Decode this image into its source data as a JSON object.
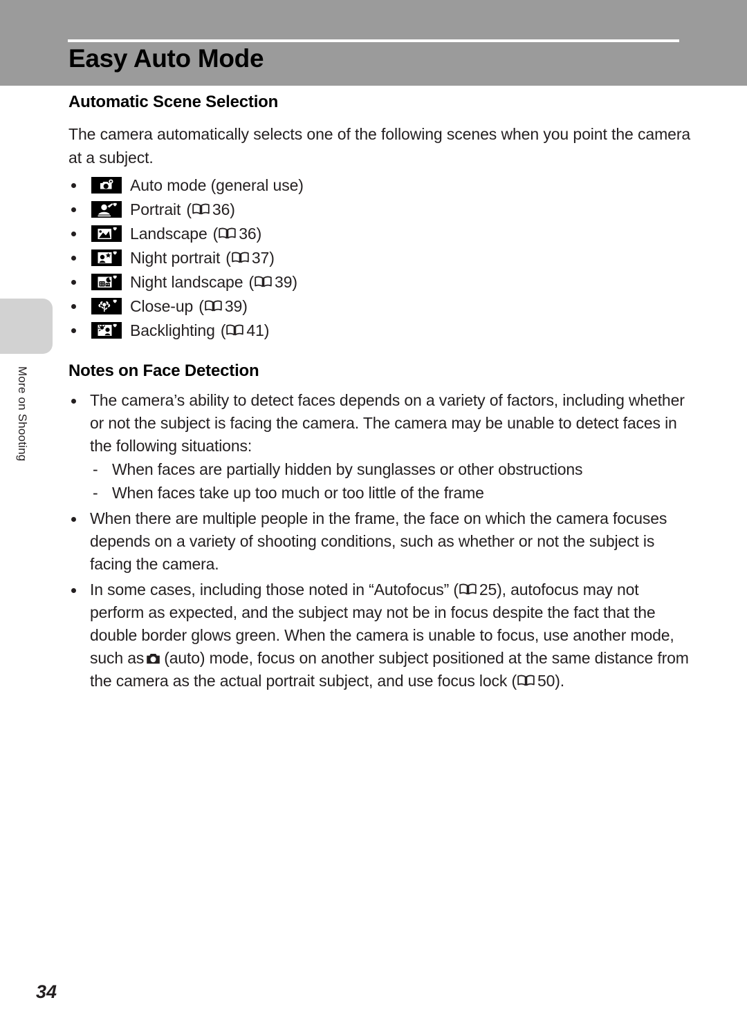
{
  "header": {
    "chapter_title": "Easy Auto Mode",
    "band_color": "#9b9b9b",
    "rule_color": "#ffffff"
  },
  "side_tab": {
    "label": "More on Shooting",
    "tab_color": "#d2d2d2"
  },
  "sections": {
    "automatic_scene_selection": {
      "heading": "Automatic Scene Selection",
      "intro": "The camera automatically selects one of the following scenes when you point the camera at a subject.",
      "scenes": [
        {
          "icon": "auto-mode-icon",
          "label": "Auto mode (general use)",
          "ref_page": ""
        },
        {
          "icon": "portrait-icon",
          "label": "Portrait",
          "ref_open": "(",
          "ref_page": "36",
          "ref_close": ")"
        },
        {
          "icon": "landscape-icon",
          "label": "Landscape",
          "ref_open": "(",
          "ref_page": "36",
          "ref_close": ")"
        },
        {
          "icon": "night-portrait-icon",
          "label": "Night portrait",
          "ref_open": "(",
          "ref_page": "37",
          "ref_close": ")"
        },
        {
          "icon": "night-landscape-icon",
          "label": "Night landscape",
          "ref_open": "(",
          "ref_page": "39",
          "ref_close": ")"
        },
        {
          "icon": "close-up-icon",
          "label": "Close-up",
          "ref_open": "(",
          "ref_page": "39",
          "ref_close": ")"
        },
        {
          "icon": "backlighting-icon",
          "label": "Backlighting",
          "ref_open": "(",
          "ref_page": "41",
          "ref_close": ")"
        }
      ]
    },
    "notes_on_face_detection": {
      "heading": "Notes on Face Detection",
      "bullet_1": "The camera’s ability to detect faces depends on a variety of factors, including whether or not the subject is facing the camera. The camera may be unable to detect faces in the following situations:",
      "sub_bullets": [
        {
          "dash": "-",
          "text": "When faces are partially hidden by sunglasses or other obstructions"
        },
        {
          "dash": "-",
          "text": "When faces take up too much or too little of the frame"
        }
      ],
      "bullet_2": "When there are multiple people in the frame, the face on which the camera focuses depends on a variety of shooting conditions, such as whether or not the subject is facing the camera.",
      "bullet_3_part_a": "In some cases, including those noted in “Autofocus” (",
      "bullet_3_ref_a": "25",
      "bullet_3_part_b": "), autofocus may not perform as expected, and the subject may not be in focus despite the fact that the double border glows green. When the camera is unable to focus, use another mode, such as",
      "bullet_3_part_c": "(auto) mode, focus on another subject positioned at the same distance from the camera as the actual portrait subject, and use focus lock (",
      "bullet_3_ref_b": "50",
      "bullet_3_part_d": ")."
    }
  },
  "footer": {
    "page_number": "34"
  }
}
